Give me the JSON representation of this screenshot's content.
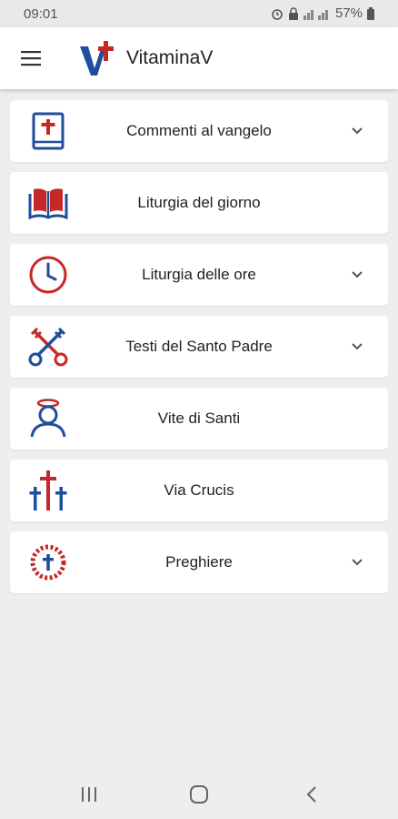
{
  "status_bar": {
    "time": "09:01",
    "battery_percent": "57%",
    "icons": [
      "alarm-icon",
      "signal-icon",
      "battery-icon"
    ]
  },
  "app_bar": {
    "title": "VitaminaV",
    "menu_icon": "hamburger-icon",
    "logo": "vitaminav-logo"
  },
  "colors": {
    "blue": "#1f4e9c",
    "red": "#c62828",
    "chevron": "#555555"
  },
  "menu": {
    "items": [
      {
        "label": "Commenti al vangelo",
        "icon": "bible-icon",
        "expandable": true
      },
      {
        "label": "Liturgia del giorno",
        "icon": "open-book-icon",
        "expandable": false
      },
      {
        "label": "Liturgia delle ore",
        "icon": "clock-icon",
        "expandable": true
      },
      {
        "label": "Testi del Santo Padre",
        "icon": "crossed-keys-icon",
        "expandable": true
      },
      {
        "label": "Vite di Santi",
        "icon": "saint-halo-icon",
        "expandable": false
      },
      {
        "label": "Via Crucis",
        "icon": "three-crosses-icon",
        "expandable": false
      },
      {
        "label": "Preghiere",
        "icon": "rosary-icon",
        "expandable": true
      }
    ]
  },
  "nav_bar": {
    "buttons": [
      "recent-apps-icon",
      "home-icon",
      "back-icon"
    ]
  }
}
